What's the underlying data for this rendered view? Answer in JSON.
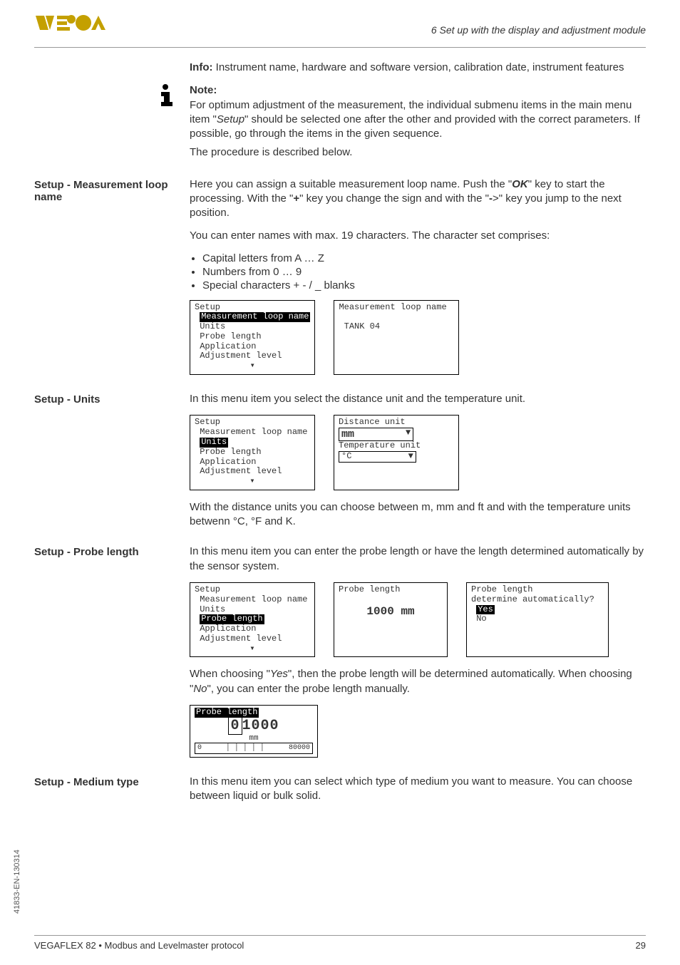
{
  "header": {
    "section": "6 Set up with the display and adjustment module"
  },
  "intro": {
    "info_line": "Info: Instrument name, hardware and software version, calibration date, instrument features",
    "info_label": "Info:",
    "info_text": " Instrument name, hardware and software version, calibration date, instrument features"
  },
  "note": {
    "title": "Note:",
    "body": "For optimum adjustment of the measurement, the individual submenu items in the main menu item \"Setup\" should be selected one after the other and provided with the correct parameters. If possible, go through the items in the given sequence.",
    "italic_word": "Setup",
    "trailer": "The procedure is described below."
  },
  "loop": {
    "heading": "Setup - Measurement loop name",
    "p1_a": "Here you can assign a suitable measurement loop name. Push the \"",
    "p1_ok": "OK",
    "p1_b": "\" key to start the processing. With the \"",
    "p1_plus": "+",
    "p1_c": "\" key you change the sign and with the \"",
    "p1_arrow": "-",
    "p1_d": ">\" key you jump to the next position.",
    "p2": "You can enter names with max. 19 characters. The character set comprises:",
    "bullet1": "Capital letters from A … Z",
    "bullet2": "Numbers from 0 … 9",
    "bullet3": "Special characters + - / _ blanks",
    "lcd1": {
      "l1": "Setup",
      "l2": "Measurement loop name",
      "l3": "Units",
      "l4": "Probe length",
      "l5": "Application",
      "l6": "Adjustment level"
    },
    "lcd2": {
      "l1": "Measurement loop name",
      "l2": "TANK 04"
    }
  },
  "units": {
    "heading": "Setup - Units",
    "p1": "In this menu item you select the distance unit and the temperature unit.",
    "lcd1": {
      "l1": "Setup",
      "l2": "Measurement loop name",
      "l3": "Units",
      "l4": "Probe length",
      "l5": "Application",
      "l6": "Adjustment level"
    },
    "lcd2": {
      "l1": "Distance unit",
      "v1": "mm",
      "l2": "Temperature unit",
      "v2": "°C"
    },
    "p2": "With the distance units you can choose between m, mm and ft and with the temperature units betwenn °C, °F and K."
  },
  "probe": {
    "heading": "Setup - Probe length",
    "p1": "In this menu item you can enter the probe length or have the length determined automatically by the sensor system.",
    "lcd1": {
      "l1": "Setup",
      "l2": "Measurement loop name",
      "l3": "Units",
      "l4": "Probe length",
      "l5": "Application",
      "l6": "Adjustment level"
    },
    "lcd2": {
      "l1": "Probe length",
      "v1": "1000 mm"
    },
    "lcd3": {
      "l1": "Probe length",
      "l2": "determine automatically?",
      "yes": "Yes",
      "no": "No"
    },
    "p2_a": "When choosing \"",
    "p2_yes": "Yes",
    "p2_b": "\", then the probe length will be determined automatically. When choosing \"",
    "p2_no": "No",
    "p2_c": "\", you can enter the probe length manually.",
    "lcd4": {
      "l1": "Probe length",
      "big": "01000",
      "unit": "mm",
      "min": "0",
      "max": "80000"
    }
  },
  "medium": {
    "heading": "Setup - Medium type",
    "p1": "In this menu item you can select which type of medium you want to measure. You can choose between liquid or bulk solid."
  },
  "footer": {
    "left": "VEGAFLEX 82 • Modbus and Levelmaster protocol",
    "right": "29"
  },
  "side_code": "41833-EN-130314"
}
